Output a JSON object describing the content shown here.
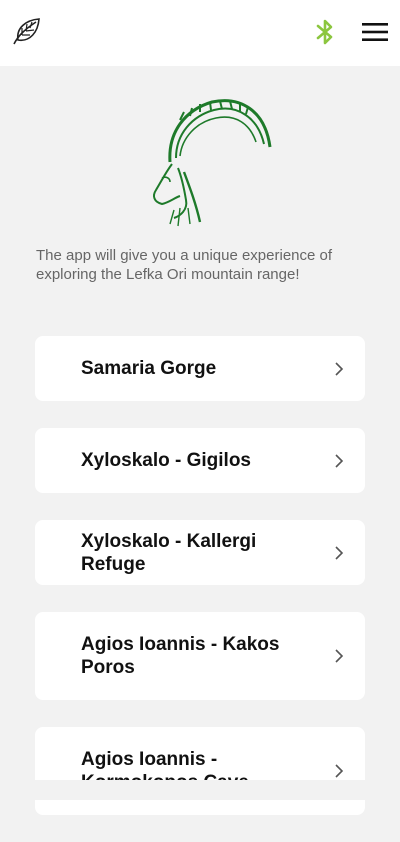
{
  "header": {
    "logo_icon": "leaf-icon",
    "bluetooth_icon": "bluetooth-icon",
    "menu_icon": "hamburger-menu-icon",
    "accent_color": "#8cc63f"
  },
  "hero": {
    "illustration": "ibex-goat-head-illustration",
    "intro_text": "The app will give you a unique experience of exploring the Lefka Ori mountain range!"
  },
  "routes": [
    {
      "name": "Samaria Gorge"
    },
    {
      "name": "Xyloskalo - Gigilos"
    },
    {
      "name": "Xyloskalo - Kallergi Refuge"
    },
    {
      "name": "Agios Ioannis - Kakos Poros"
    },
    {
      "name": "Agios Ioannis - Kormokopos Cave"
    }
  ]
}
